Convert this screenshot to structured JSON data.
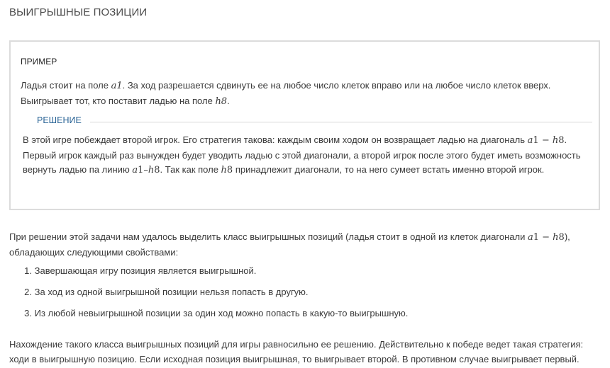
{
  "page_title": "ВЫИГРЫШНЫЕ ПОЗИЦИИ",
  "example": {
    "heading": "ПРИМЕР",
    "text_1": "Ладья стоит на поле ",
    "math_1": "a1",
    "text_2": ". За ход разрешается сдвинуть ее на любое число клеток вправо или на любое число клеток вверх. Выигрывает тот, кто поставит ладью на поле ",
    "math_2": "h8",
    "text_3": ".",
    "solution_label": "РЕШЕНИЕ",
    "solution": {
      "text_1": "В этой игре побеждает второй игрок. Его стратегия такова: каждым своим ходом он возвращает ладью на диагональ ",
      "math_1a": "a",
      "math_1b": "1 − ",
      "math_1c": "h",
      "math_1d": "8",
      "text_2": ". Первый игрок каждый раз вынужден будет уводить ладью с этой диагонали, а второй игрок после этого будет иметь возможность вернуть ладью па линию ",
      "math_2a": "a",
      "math_2b": "1–",
      "math_2c": "h",
      "math_2d": "8",
      "text_3": ". Так как поле ",
      "math_3a": "h",
      "math_3b": "8",
      "text_4": " принадлежит диагонали, то на него сумеет встать именно второй игрок."
    }
  },
  "intro": {
    "text_1": "При решении этой задачи нам удалось выделить класс выигрышных позиций (ладья стоит в одной из клеток диагонали ",
    "math_a": "a",
    "math_b": "1 − ",
    "math_c": "h",
    "math_d": "8",
    "text_2": "), обладающих следующими свойствами:"
  },
  "properties": [
    {
      "num": "1.",
      "text": "Завершающая игру позиция является выигрышной."
    },
    {
      "num": "2.",
      "text": "За ход из одной выигрышной позиции нельзя попасть в другую."
    },
    {
      "num": "3.",
      "text": "Из любой невыигрышной позиции за один ход можно попасть в какую-то выигрышную."
    }
  ],
  "outro": "Нахождение такого класса выигрышных позиций для игры равносильно ее решению. Действительно к победе ведет такая стратегия: ходи в выигрышную позицию. Если исходная позиция выигрышная, то выигрывает второй. В противном случае выигрывает первый."
}
